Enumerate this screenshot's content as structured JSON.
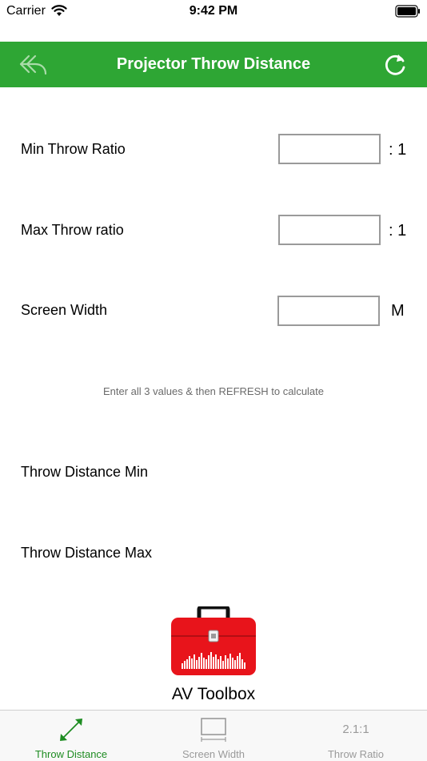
{
  "status_bar": {
    "carrier": "Carrier",
    "time": "9:42 PM",
    "wifi_icon": "wifi-icon",
    "battery_icon": "battery-icon"
  },
  "nav": {
    "title": "Projector Throw Distance",
    "background_color": "#2ea634",
    "back_icon": "reply-arrow-icon",
    "refresh_icon": "refresh-icon"
  },
  "inputs": {
    "min_throw_ratio": {
      "label": "Min Throw Ratio",
      "value": "",
      "unit": ": 1"
    },
    "max_throw_ratio": {
      "label": "Max Throw ratio",
      "value": "",
      "unit": ": 1"
    },
    "screen_width": {
      "label": "Screen Width",
      "value": "",
      "unit": "M"
    }
  },
  "hint": "Enter all 3 values & then REFRESH to calculate",
  "results": {
    "throw_distance_min": "Throw Distance Min",
    "throw_distance_max": "Throw Distance Max"
  },
  "branding": {
    "logo_icon": "toolbox-icon",
    "name": "AV Toolbox"
  },
  "tabs": [
    {
      "label": "Throw Distance",
      "icon": "diagonal-arrow-icon",
      "active": true
    },
    {
      "label": "Screen Width",
      "icon": "screen-icon",
      "active": false
    },
    {
      "label": "Throw Ratio",
      "icon_text": "2.1:1",
      "active": false
    }
  ],
  "colors": {
    "accent": "#2ea634",
    "active_tab": "#1e8c22",
    "inactive_tab": "#9a9a9a",
    "toolbox_red": "#e8141b"
  }
}
